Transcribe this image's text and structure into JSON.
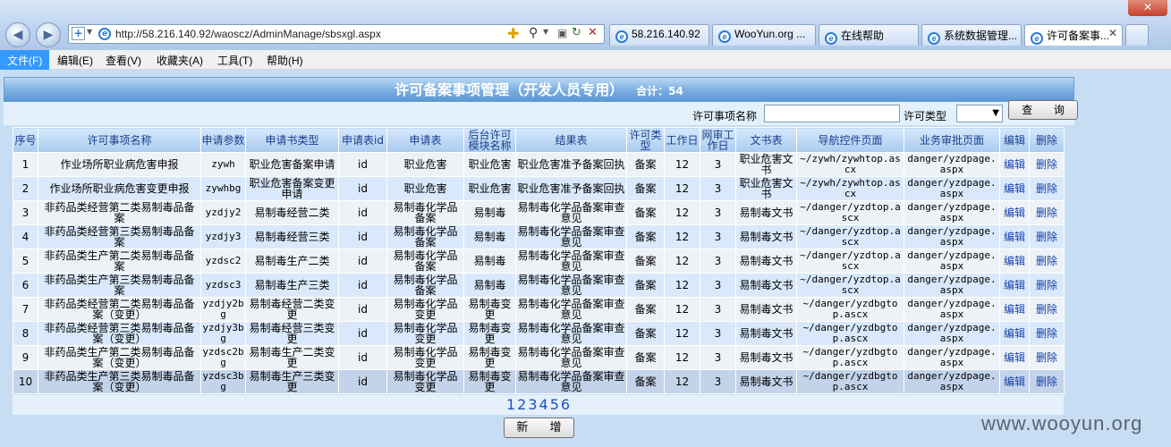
{
  "browser": {
    "url": "http://58.216.140.92/waoscz/AdminManage/sbsxgl.aspx",
    "tabs": [
      {
        "label": "58.216.140.92"
      },
      {
        "label": "WooYun.org ..."
      },
      {
        "label": "在线帮助"
      },
      {
        "label": "系统数据管理..."
      },
      {
        "label": "许可备案事..."
      }
    ],
    "menu": [
      "文件(F)",
      "编辑(E)",
      "查看(V)",
      "收藏夹(A)",
      "工具(T)",
      "帮助(H)"
    ]
  },
  "page": {
    "title": "许可备案事项管理（开发人员专用）",
    "count": "合计：54",
    "search": {
      "name_label": "许可事项名称",
      "type_label": "许可类型",
      "query_button": "查 询"
    },
    "columns": [
      "序号",
      "许可事项名称",
      "申请参数",
      "申请书类型",
      "申请表id",
      "申请表",
      "后台许可模块名称",
      "结果表",
      "许可类型",
      "工作日",
      "网审工作日",
      "文书表",
      "导航控件页面",
      "业务审批页面",
      "编辑",
      "删除"
    ],
    "rows": [
      [
        "1",
        "作业场所职业病危害申报",
        "zywh",
        "职业危害备案申请",
        "id",
        "职业危害",
        "职业危害",
        "职业危害准予备案回执",
        "备案",
        "12",
        "3",
        "职业危害文书",
        "~/zywh/zywhtop.ascx",
        "danger/yzdpage.aspx",
        "编辑",
        "删除"
      ],
      [
        "2",
        "作业场所职业病危害变更申报",
        "zywhbg",
        "职业危害备案变更申请",
        "id",
        "职业危害",
        "职业危害",
        "职业危害准予备案回执",
        "备案",
        "12",
        "3",
        "职业危害文书",
        "~/zywh/zywhtop.ascx",
        "danger/yzdpage.aspx",
        "编辑",
        "删除"
      ],
      [
        "3",
        "非药品类经营第二类易制毒品备案",
        "yzdjy2",
        "易制毒经营二类",
        "id",
        "易制毒化学品备案",
        "易制毒",
        "易制毒化学品备案审查意见",
        "备案",
        "12",
        "3",
        "易制毒文书",
        "~/danger/yzdtop.ascx",
        "danger/yzdpage.aspx",
        "编辑",
        "删除"
      ],
      [
        "4",
        "非药品类经营第三类易制毒品备案",
        "yzdjy3",
        "易制毒经营三类",
        "id",
        "易制毒化学品备案",
        "易制毒",
        "易制毒化学品备案审查意见",
        "备案",
        "12",
        "3",
        "易制毒文书",
        "~/danger/yzdtop.ascx",
        "danger/yzdpage.aspx",
        "编辑",
        "删除"
      ],
      [
        "5",
        "非药品类生产第二类易制毒品备案",
        "yzdsc2",
        "易制毒生产二类",
        "id",
        "易制毒化学品备案",
        "易制毒",
        "易制毒化学品备案审查意见",
        "备案",
        "12",
        "3",
        "易制毒文书",
        "~/danger/yzdtop.ascx",
        "danger/yzdpage.aspx",
        "编辑",
        "删除"
      ],
      [
        "6",
        "非药品类生产第三类易制毒品备案",
        "yzdsc3",
        "易制毒生产三类",
        "id",
        "易制毒化学品备案",
        "易制毒",
        "易制毒化学品备案审查意见",
        "备案",
        "12",
        "3",
        "易制毒文书",
        "~/danger/yzdtop.ascx",
        "danger/yzdpage.aspx",
        "编辑",
        "删除"
      ],
      [
        "7",
        "非药品类经营第二类易制毒品备案（变更）",
        "yzdjy2bg",
        "易制毒经营二类变更",
        "id",
        "易制毒化学品变更",
        "易制毒变更",
        "易制毒化学品备案审查意见",
        "备案",
        "12",
        "3",
        "易制毒文书",
        "~/danger/yzdbgtop.ascx",
        "danger/yzdpage.aspx",
        "编辑",
        "删除"
      ],
      [
        "8",
        "非药品类经营第三类易制毒品备案（变更）",
        "yzdjy3bg",
        "易制毒经营三类变更",
        "id",
        "易制毒化学品变更",
        "易制毒变更",
        "易制毒化学品备案审查意见",
        "备案",
        "12",
        "3",
        "易制毒文书",
        "~/danger/yzdbgtop.ascx",
        "danger/yzdpage.aspx",
        "编辑",
        "删除"
      ],
      [
        "9",
        "非药品类生产第二类易制毒品备案（变更）",
        "yzdsc2bg",
        "易制毒生产二类变更",
        "id",
        "易制毒化学品变更",
        "易制毒变更",
        "易制毒化学品备案审查意见",
        "备案",
        "12",
        "3",
        "易制毒文书",
        "~/danger/yzdbgtop.ascx",
        "danger/yzdpage.aspx",
        "编辑",
        "删除"
      ],
      [
        "10",
        "非药品类生产第三类易制毒品备案（变更）",
        "yzdsc3bg",
        "易制毒生产三类变更",
        "id",
        "易制毒化学品变更",
        "易制毒变更",
        "易制毒化学品备案审查意见",
        "备案",
        "12",
        "3",
        "易制毒文书",
        "~/danger/yzdbgtop.ascx",
        "danger/yzdpage.aspx",
        "编辑",
        "删除"
      ]
    ],
    "pages": [
      "1",
      "2",
      "3",
      "4",
      "5",
      "6"
    ],
    "add_button": "新 增",
    "watermark": "www.wooyun.org"
  }
}
